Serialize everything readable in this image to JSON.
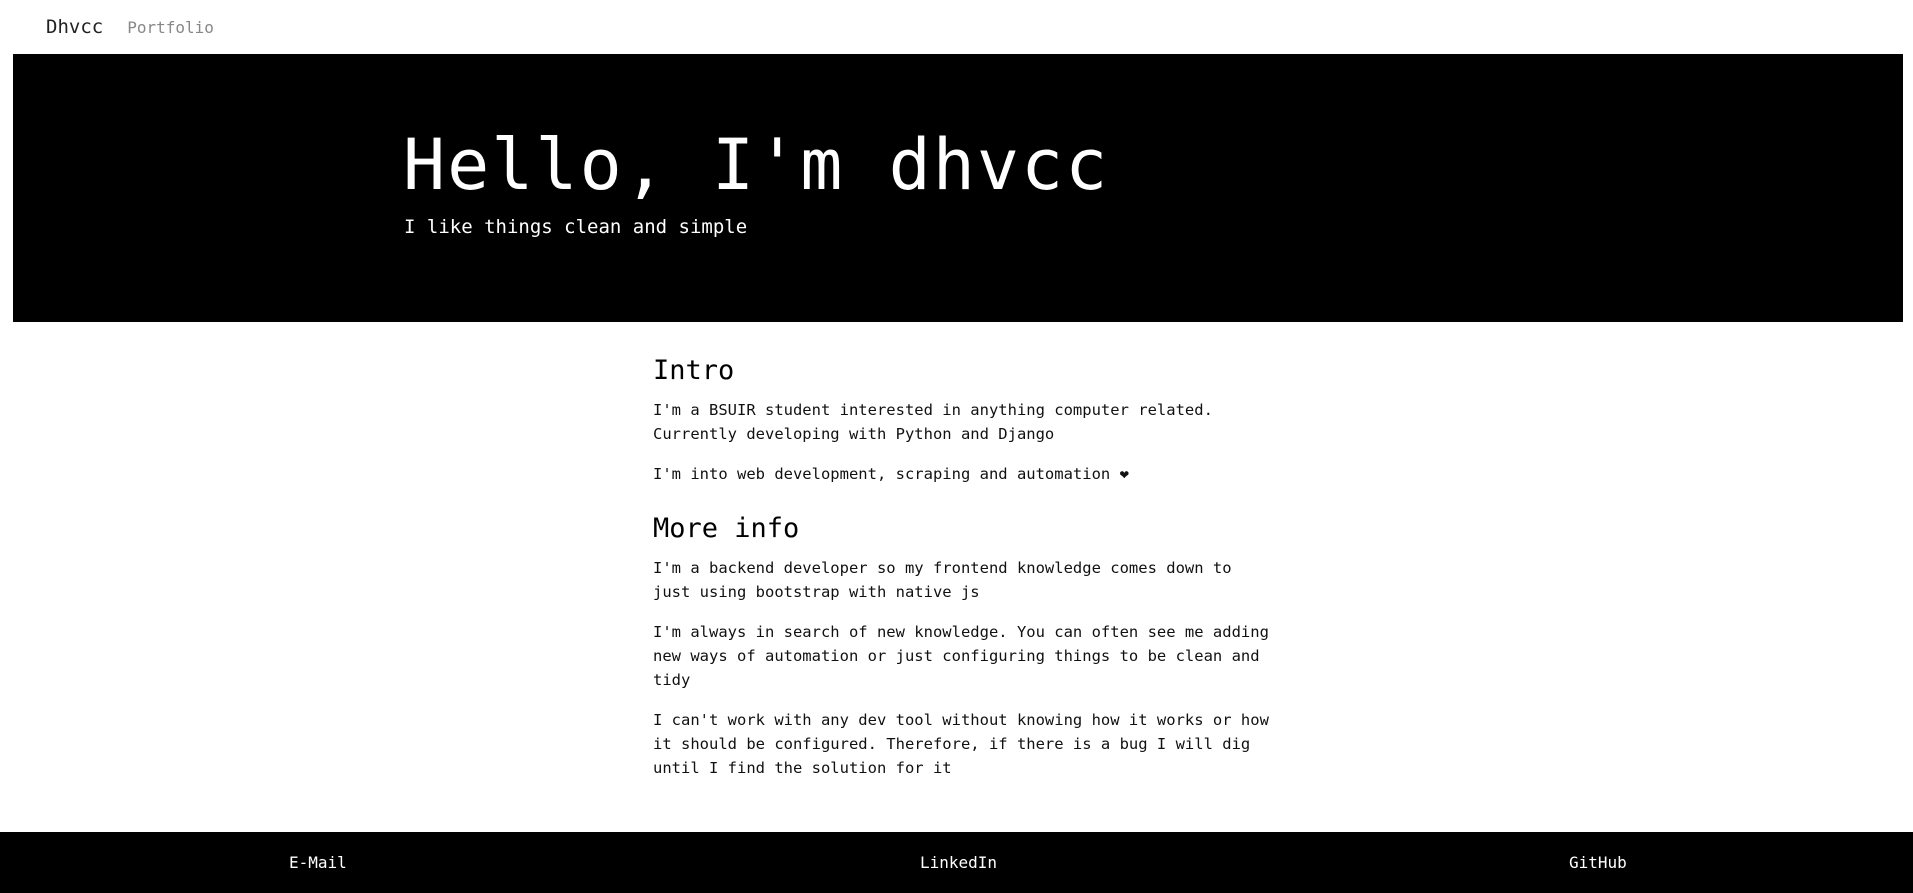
{
  "navbar": {
    "brand": "Dhvcc",
    "links": [
      "Portfolio"
    ]
  },
  "hero": {
    "title": "Hello, I'm dhvcc",
    "subtitle": "I like things clean and simple"
  },
  "sections": [
    {
      "heading": "Intro",
      "paragraphs": [
        "I'm a BSUIR student interested in anything computer related. Currently developing with Python and Django",
        "I'm into web development, scraping and automation ❤"
      ]
    },
    {
      "heading": "More info",
      "paragraphs": [
        "I'm a backend developer so my frontend knowledge comes down to just using bootstrap with native js",
        "I'm always in search of new knowledge. You can often see me adding new ways of automation or just configuring things to be clean and tidy",
        "I can't work with any dev tool without knowing how it works or how it should be configured. Therefore, if there is a bug I will dig until I find the solution for it"
      ]
    }
  ],
  "footer": {
    "links": [
      "E-Mail",
      "LinkedIn",
      "GitHub"
    ]
  },
  "colors": {
    "hero_background": "#000000",
    "footer_background": "#000000",
    "nav_link": "#888888"
  }
}
